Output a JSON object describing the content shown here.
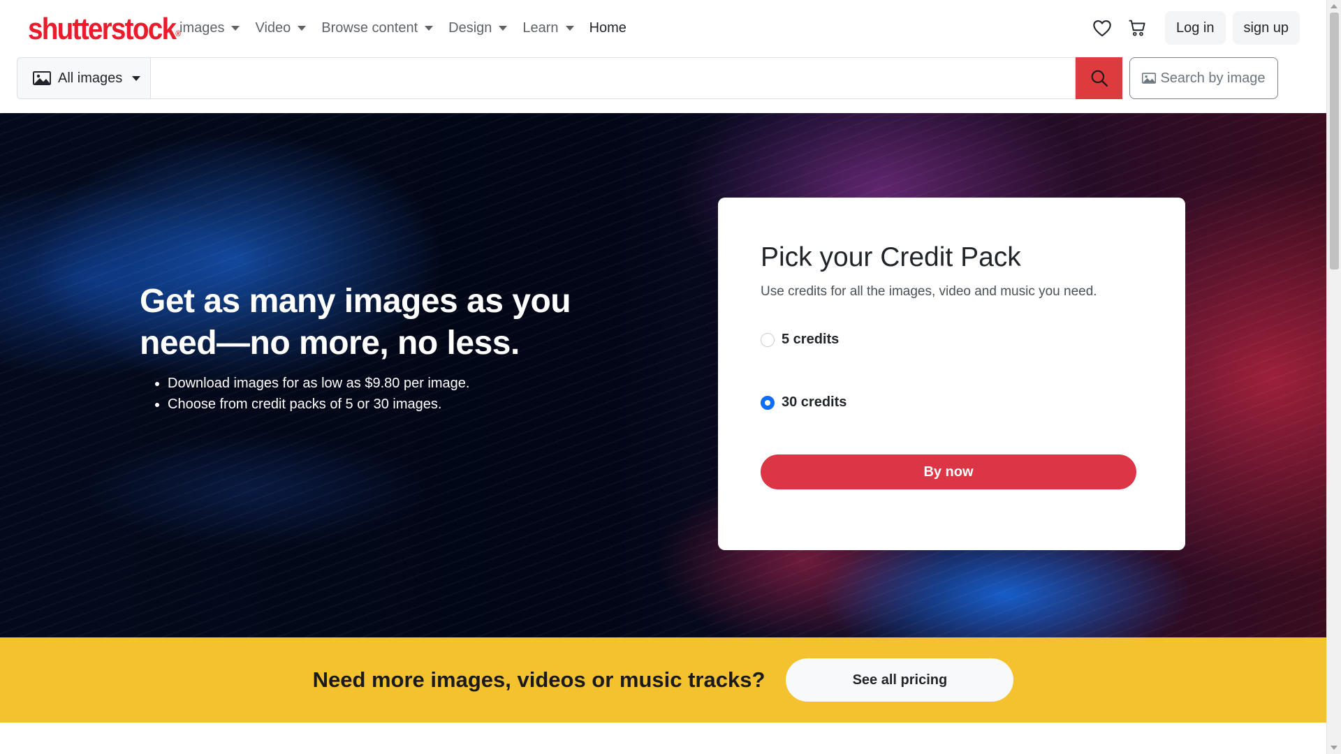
{
  "brand": {
    "logo_text": "shutterstock",
    "color": "#ea1c2c"
  },
  "nav": {
    "items": [
      {
        "label": "images",
        "has_dropdown": true
      },
      {
        "label": "Video",
        "has_dropdown": true
      },
      {
        "label": "Browse content",
        "has_dropdown": true
      },
      {
        "label": "Design",
        "has_dropdown": true
      },
      {
        "label": "Learn",
        "has_dropdown": true
      },
      {
        "label": "Home",
        "has_dropdown": false
      }
    ],
    "favorites_icon": "heart-icon",
    "cart_icon": "cart-icon",
    "login_label": "Log in",
    "signup_label": "sign up"
  },
  "search": {
    "type_label": "All images",
    "type_icon": "image-icon",
    "value": "",
    "placeholder": "",
    "button_icon": "search-icon",
    "button_color": "#dd3b3e",
    "by_image_label": "Search by image"
  },
  "hero": {
    "title": "Get as many images as you need—no more, no less.",
    "bullets": [
      "Download images for as low as $9.80 per image.",
      "Choose from credit packs of 5 or 30 images."
    ]
  },
  "credit_card": {
    "title": "Pick your Credit Pack",
    "subtitle": "Use credits for all the images, video and music you need.",
    "options": [
      {
        "label": "5 credits",
        "selected": false
      },
      {
        "label": "30 credits",
        "selected": true
      }
    ],
    "button_label": "By now",
    "button_color": "#dc3545"
  },
  "pricing_band": {
    "text": "Need more images, videos or music tracks?",
    "button_label": "See all pricing",
    "background": "#f4c22f"
  }
}
